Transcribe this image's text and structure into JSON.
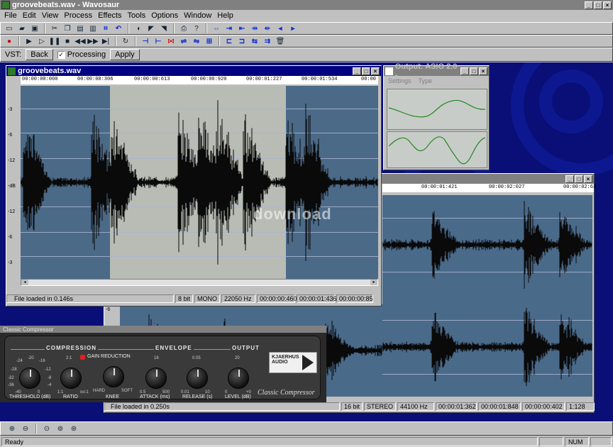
{
  "app": {
    "title": "groovebeats.wav - Wavosaur"
  },
  "menu": [
    "File",
    "Edit",
    "View",
    "Process",
    "Effects",
    "Tools",
    "Options",
    "Window",
    "Help"
  ],
  "toolbar1": [
    "new-icon",
    "open-icon",
    "save-icon",
    "cut-icon",
    "copy-icon",
    "paste-icon",
    "mix-paste-icon",
    "crop-icon",
    "undo-icon",
    "normalize-icon",
    "fade-in-icon",
    "fade-out-icon",
    "print-icon",
    "help-icon",
    "select-all-icon",
    "zoom-in-icon",
    "zoom-out-icon",
    "go-start-icon",
    "go-end-icon",
    "prev-marker-icon",
    "next-marker-icon"
  ],
  "toolbar2": [
    "record-icon",
    "play-icon",
    "pause-icon",
    "stop-icon",
    "loop-icon",
    "rewind-icon",
    "fast-forward-icon",
    "go-end-icon",
    "loop-mode-icon",
    "marker-icon",
    "region-icon",
    "normalize-icon",
    "reverse-icon",
    "invert-icon",
    "vst-icon",
    "insert-silence-icon",
    "trim-icon",
    "resample-icon",
    "delete-icon"
  ],
  "vst": {
    "label": "VST:",
    "back": "Back",
    "processing": "Processing",
    "apply": "Apply"
  },
  "waveform_main": {
    "title": "groovebeats.wav",
    "ruler": [
      "00:00:00:000",
      "00:00:00:306",
      "00:00:00:613",
      "00:00:00:920",
      "00:00:01:227",
      "00:00:01:534",
      "00:00"
    ],
    "db_scale": [
      "-3",
      "-6",
      "-12",
      "-dB",
      "-12",
      "-6",
      "-3"
    ],
    "status": [
      "File loaded in 0.146s",
      "8 bit",
      "MONO",
      "22050 Hz",
      "00:00:00:460",
      "00:00:01:436",
      "00:00:00:85"
    ]
  },
  "output_window": {
    "title": "Output: ASIO 2.0 -",
    "menu": [
      "Settings",
      "Type"
    ]
  },
  "waveform_second": {
    "ruler": [
      "00:00:01:421",
      "00:00:02:027",
      "00:00:02:63"
    ],
    "db_scale": [
      "-6"
    ],
    "status": [
      "File loaded in 0.250s",
      "16 bit",
      "STEREO",
      "44100 Hz",
      "00:00:01:362",
      "00:00:01:848",
      "00:00:00:402",
      "1:128"
    ]
  },
  "watermark": "download",
  "compressor": {
    "title": "Classic Compressor",
    "sections": [
      "COMPRESSION",
      "ENVELOPE",
      "OUTPUT"
    ],
    "gain_reduction": "GAIN REDUCTION",
    "knobs": [
      {
        "label": "THRESHOLD (dB)",
        "ticks": [
          "-24",
          "-20",
          "-16",
          "-28",
          "-12",
          "-32",
          "-8",
          "-36",
          "-4",
          "-40",
          "0"
        ]
      },
      {
        "label": "RATIO",
        "ticks": [
          "2:1",
          "1:1",
          "oo:1"
        ]
      },
      {
        "label": "KNEE",
        "ticks": [
          "HARD",
          "SOFT"
        ]
      },
      {
        "label": "ATTACK (ms)",
        "ticks": [
          "16",
          "0.5",
          "500"
        ]
      },
      {
        "label": "RELEASE (s)",
        "ticks": [
          "0.05",
          "0.01",
          "10"
        ]
      },
      {
        "label": "LEVEL (dB)",
        "ticks": [
          "20",
          "0",
          "+0"
        ]
      }
    ],
    "logo_text": "KJAERHUS AUDIO",
    "brand": "Classic Compressor"
  },
  "status": {
    "main": "Ready",
    "num": "NUM"
  },
  "zoom_icons": [
    "zoom-in-icon",
    "zoom-out-icon",
    "zoom-fit-icon",
    "zoom-selection-icon",
    "zoom-full-icon"
  ]
}
